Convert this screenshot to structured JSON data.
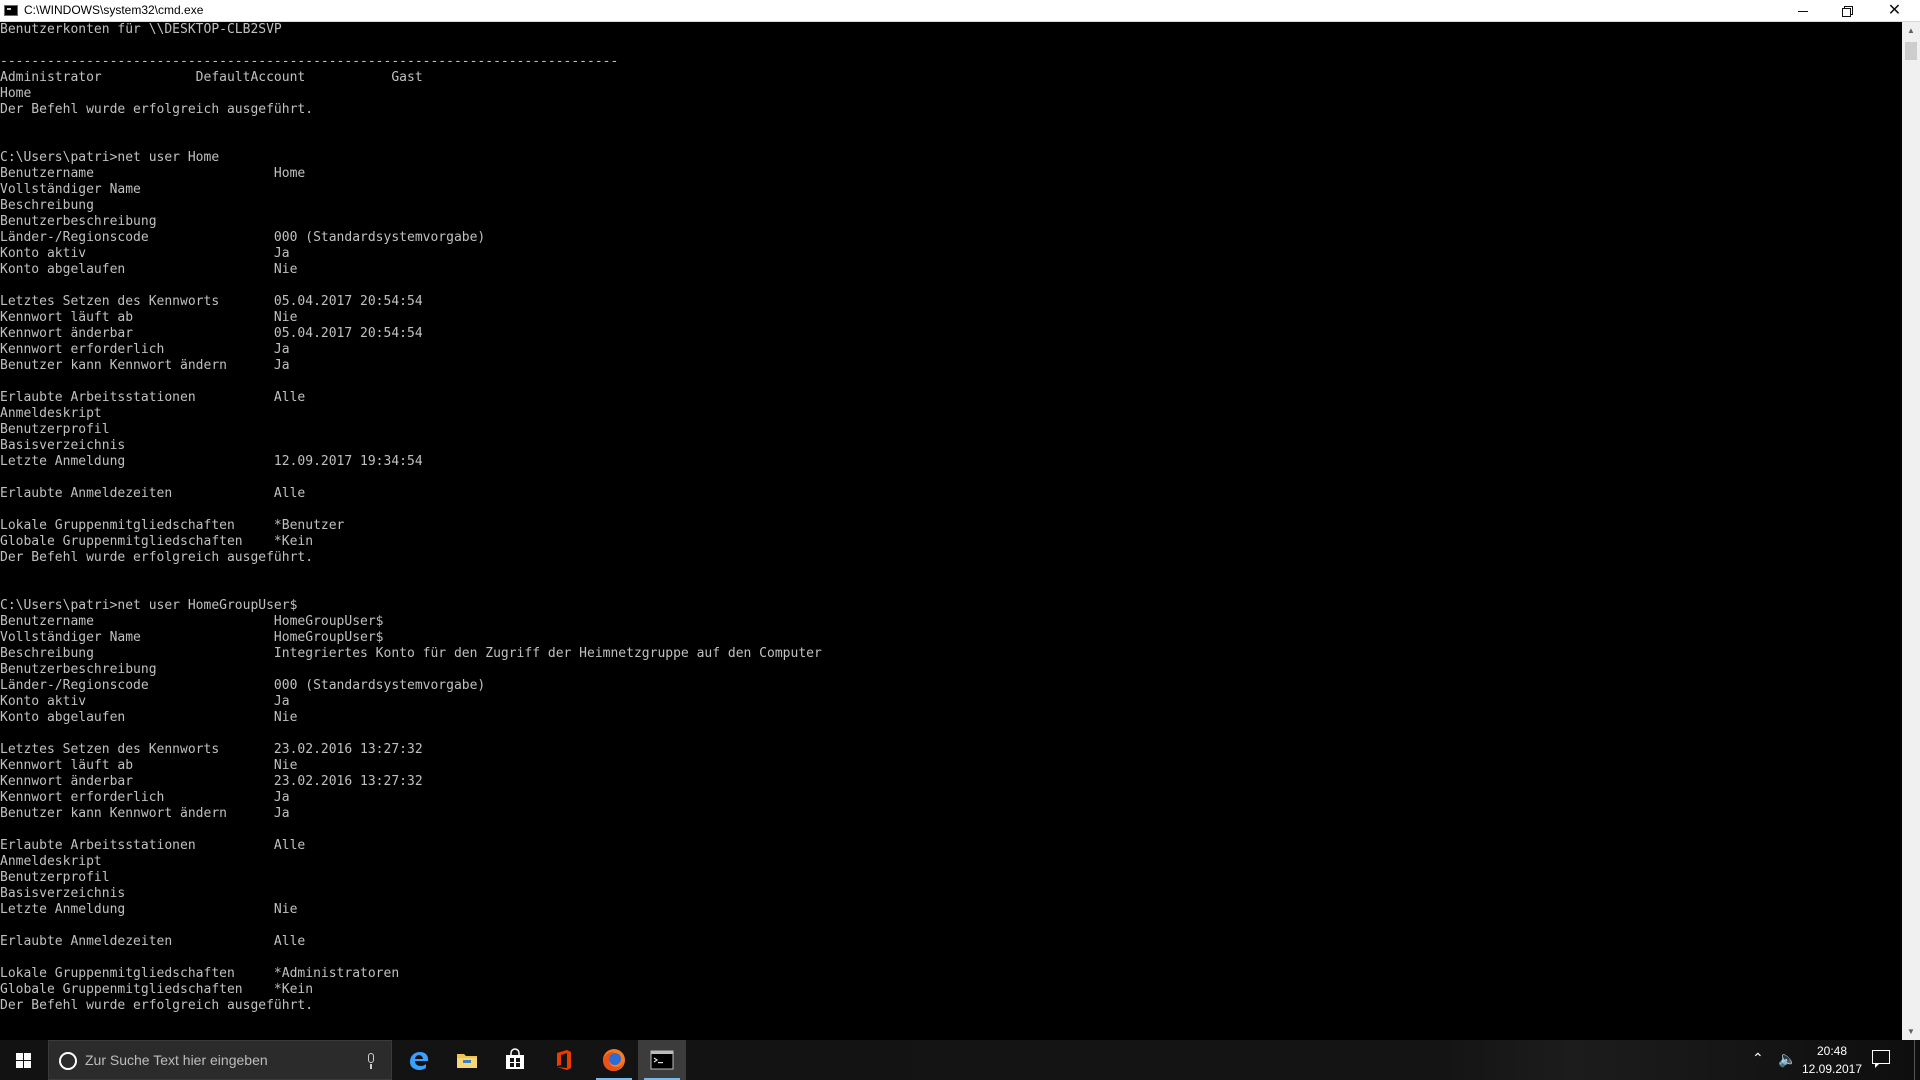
{
  "window": {
    "title": "C:\\WINDOWS\\system32\\cmd.exe",
    "controls": {
      "minimize": "minimize",
      "maximize": "restore",
      "close": "close"
    }
  },
  "console": {
    "lines": [
      "Benutzerkonten für \\\\DESKTOP-CLB2SVP",
      "",
      "-------------------------------------------------------------------------------",
      "Administrator            DefaultAccount           Gast",
      "Home",
      "Der Befehl wurde erfolgreich ausgeführt.",
      "",
      "",
      "C:\\Users\\patri>net user Home",
      "Benutzername                       Home",
      "Vollständiger Name",
      "Beschreibung",
      "Benutzerbeschreibung",
      "Länder-/Regionscode                000 (Standardsystemvorgabe)",
      "Konto aktiv                        Ja",
      "Konto abgelaufen                   Nie",
      "",
      "Letztes Setzen des Kennworts       05.04.2017 20:54:54",
      "Kennwort läuft ab                  Nie",
      "Kennwort änderbar                  05.04.2017 20:54:54",
      "Kennwort erforderlich              Ja",
      "Benutzer kann Kennwort ändern      Ja",
      "",
      "Erlaubte Arbeitsstationen          Alle",
      "Anmeldeskript",
      "Benutzerprofil",
      "Basisverzeichnis",
      "Letzte Anmeldung                   12.09.2017 19:34:54",
      "",
      "Erlaubte Anmeldezeiten             Alle",
      "",
      "Lokale Gruppenmitgliedschaften     *Benutzer",
      "Globale Gruppenmitgliedschaften    *Kein",
      "Der Befehl wurde erfolgreich ausgeführt.",
      "",
      "",
      "C:\\Users\\patri>net user HomeGroupUser$",
      "Benutzername                       HomeGroupUser$",
      "Vollständiger Name                 HomeGroupUser$",
      "Beschreibung                       Integriertes Konto für den Zugriff der Heimnetzgruppe auf den Computer",
      "Benutzerbeschreibung",
      "Länder-/Regionscode                000 (Standardsystemvorgabe)",
      "Konto aktiv                        Ja",
      "Konto abgelaufen                   Nie",
      "",
      "Letztes Setzen des Kennworts       23.02.2016 13:27:32",
      "Kennwort läuft ab                  Nie",
      "Kennwort änderbar                  23.02.2016 13:27:32",
      "Kennwort erforderlich              Ja",
      "Benutzer kann Kennwort ändern      Ja",
      "",
      "Erlaubte Arbeitsstationen          Alle",
      "Anmeldeskript",
      "Benutzerprofil",
      "Basisverzeichnis",
      "Letzte Anmeldung                   Nie",
      "",
      "Erlaubte Anmeldezeiten             Alle",
      "",
      "Lokale Gruppenmitgliedschaften     *Administratoren",
      "Globale Gruppenmitgliedschaften    *Kein",
      "Der Befehl wurde erfolgreich ausgeführt."
    ],
    "text_color": "#c0c0c0",
    "background_color": "#000000"
  },
  "taskbar": {
    "search_placeholder": "Zur Suche Text hier eingeben",
    "apps": [
      "edge-icon",
      "file-explorer-icon",
      "store-icon",
      "office-icon",
      "firefox-icon",
      "cmd-icon"
    ],
    "active_app": "cmd-icon",
    "clock": {
      "time": "20:48",
      "date": "12.09.2017"
    }
  }
}
